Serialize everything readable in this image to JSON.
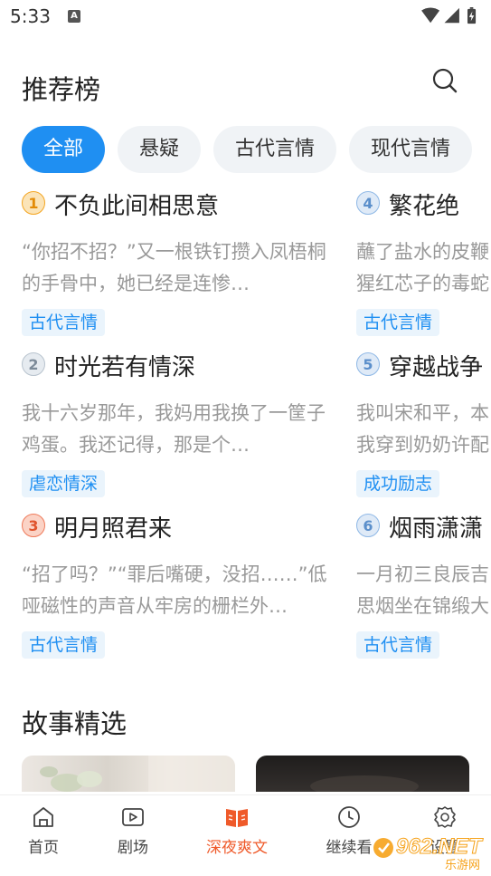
{
  "status": {
    "time": "5:33",
    "notif_letter": "A"
  },
  "header": {
    "title": "推荐榜"
  },
  "tabs": [
    {
      "label": "全部",
      "active": true
    },
    {
      "label": "悬疑",
      "active": false
    },
    {
      "label": "古代言情",
      "active": false
    },
    {
      "label": "现代言情",
      "active": false
    }
  ],
  "rank": {
    "items": [
      {
        "num": "1",
        "title": "不负此间相思意",
        "desc": "“你招不招？”又一根铁钉攒入凤梧桐的手骨中，她已经是连惨…",
        "tag": "古代言情",
        "badge_color": "#f4a623"
      },
      {
        "num": "2",
        "title": "时光若有情深",
        "desc": "我十六岁那年，我妈用我换了一筐子鸡蛋。我还记得，那是个…",
        "tag": "虐恋情深",
        "badge_color": "#a8b4c0"
      },
      {
        "num": "3",
        "title": "明月照君来",
        "desc": "“招了吗？”“罪后嘴硬，没招……”低哑磁性的声音从牢房的栅栏外…",
        "tag": "古代言情",
        "badge_color": "#ef7a5a"
      },
      {
        "num": "4",
        "title": "繁花绝",
        "desc": "蘸了盐水的皮鞭猩红芯子的毒蛇",
        "tag": "古代言情",
        "badge_color": "#8fb8e6"
      },
      {
        "num": "5",
        "title": "穿越战争",
        "desc": "我叫宋和平，本我穿到奶奶许配",
        "tag": "成功励志",
        "badge_color": "#8fb8e6"
      },
      {
        "num": "6",
        "title": "烟雨潇潇",
        "desc": "一月初三良辰吉思烟坐在锦缎大",
        "tag": "古代言情",
        "badge_color": "#8fb8e6"
      }
    ]
  },
  "story": {
    "title": "故事精选"
  },
  "bottom_nav": [
    {
      "label": "首页",
      "icon": "home-icon",
      "active": false
    },
    {
      "label": "剧场",
      "icon": "video-icon",
      "active": false
    },
    {
      "label": "深夜爽文",
      "icon": "book-icon",
      "active": true
    },
    {
      "label": "继续看",
      "icon": "clock-icon",
      "active": false
    },
    {
      "label": "设置",
      "icon": "gear-icon",
      "active": false
    }
  ],
  "colors": {
    "accent": "#1f8ff2",
    "nav_active": "#ef5a2a",
    "tag_bg": "#eaf4fc"
  },
  "watermark": {
    "text": "962.NET",
    "sub": "乐游网"
  }
}
